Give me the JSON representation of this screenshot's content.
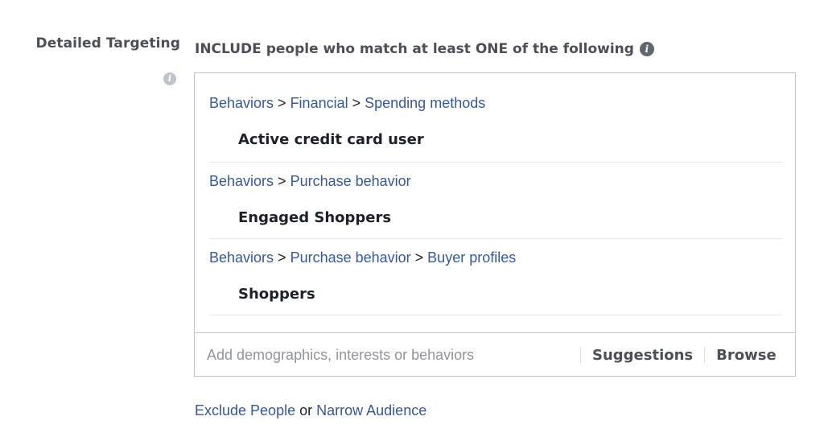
{
  "section": {
    "label": "Detailed Targeting",
    "include_heading": "INCLUDE people who match at least ONE of the following"
  },
  "icons": {
    "label_info": "info-icon",
    "heading_info": "info-icon",
    "info_glyph": "i"
  },
  "colors": {
    "link": "#365899",
    "heading": "#4b4f56",
    "text": "#1d2129",
    "placeholder": "#90949c",
    "border": "#bec3c9"
  },
  "targeting": [
    {
      "path": [
        "Behaviors",
        "Financial",
        "Spending methods"
      ],
      "item": "Active credit card user"
    },
    {
      "path": [
        "Behaviors",
        "Purchase behavior"
      ],
      "item": "Engaged Shoppers"
    },
    {
      "path": [
        "Behaviors",
        "Purchase behavior",
        "Buyer profiles"
      ],
      "item": "Shoppers"
    }
  ],
  "breadcrumb_separator": ">",
  "search": {
    "placeholder": "Add demographics, interests or behaviors",
    "value": ""
  },
  "footer": {
    "suggestions_label": "Suggestions",
    "browse_label": "Browse"
  },
  "bottom": {
    "exclude_label": "Exclude People",
    "or_label": "or",
    "narrow_label": "Narrow Audience"
  }
}
